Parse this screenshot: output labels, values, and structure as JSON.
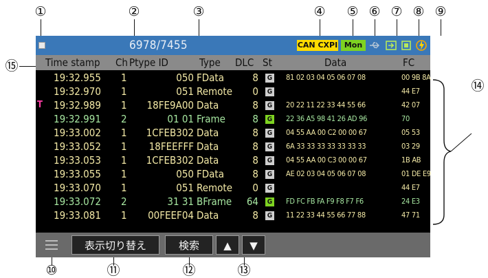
{
  "callouts": [
    "①",
    "②",
    "③",
    "④",
    "⑤",
    "⑥",
    "⑦",
    "⑧",
    "⑨",
    "⑩",
    "⑪",
    "⑫",
    "⑬",
    "⑭",
    "⑮"
  ],
  "status": {
    "frame_count": "6978/7455",
    "can_cxpi_label": "CAN CXPI",
    "mon_label": "Mon"
  },
  "columns": {
    "timestamp": "Time stamp",
    "ch": "Ch",
    "ptype": "Ptype ID",
    "type": "Type",
    "dlc": "DLC",
    "st": "St",
    "data": "Data",
    "fc": "FC"
  },
  "rows": [
    {
      "marker": "",
      "ts": "19:32.955",
      "ch": "1",
      "id": "050",
      "type": "FData",
      "dlc": "8",
      "st": "G",
      "data": "81 02 03 04 05 06 07 08",
      "fc": "00 9B 8A",
      "color": "#f3e9a6"
    },
    {
      "marker": "",
      "ts": "19:32.970",
      "ch": "1",
      "id": "051",
      "type": "Remote",
      "dlc": "0",
      "st": "G",
      "data": "",
      "fc": "44 E7",
      "color": "#f3e9a6"
    },
    {
      "marker": "T",
      "ts": "19:32.989",
      "ch": "1",
      "id": "18FE9A00",
      "type": "Data",
      "dlc": "8",
      "st": "G",
      "data": "20 22 11 22 33 44 55 66",
      "fc": "42 07",
      "color": "#f3e9a6"
    },
    {
      "marker": "",
      "ts": "19:32.991",
      "ch": "2",
      "id": "01 01",
      "type": "Frame",
      "dlc": "8",
      "st": "G",
      "data": "22 36 A5 98 41 26 AD 96",
      "fc": "70",
      "color": "#a6e6a0",
      "green": true
    },
    {
      "marker": "",
      "ts": "19:33.002",
      "ch": "1",
      "id": "1CFEB302",
      "type": "Data",
      "dlc": "8",
      "st": "G",
      "data": "04 55 AA 00 C2 00 00 67",
      "fc": "05 53",
      "color": "#f3e9a6"
    },
    {
      "marker": "",
      "ts": "19:33.052",
      "ch": "1",
      "id": "18FEEFFF",
      "type": "Data",
      "dlc": "8",
      "st": "G",
      "data": "6A 33 33 33 33 33 33 33",
      "fc": "03 29",
      "color": "#f3e9a6"
    },
    {
      "marker": "",
      "ts": "19:33.053",
      "ch": "1",
      "id": "1CFEB302",
      "type": "Data",
      "dlc": "8",
      "st": "G",
      "data": "04 55 AA 00 C3 00 00 67",
      "fc": "1B AB",
      "color": "#f3e9a6"
    },
    {
      "marker": "",
      "ts": "19:33.055",
      "ch": "1",
      "id": "050",
      "type": "FData",
      "dlc": "8",
      "st": "G",
      "data": "AE 02 03 04 05 06 07 08",
      "fc": "01 DE E9",
      "color": "#f3e9a6"
    },
    {
      "marker": "",
      "ts": "19:33.070",
      "ch": "1",
      "id": "051",
      "type": "Remote",
      "dlc": "0",
      "st": "G",
      "data": "",
      "fc": "44 E7",
      "color": "#f3e9a6"
    },
    {
      "marker": "",
      "ts": "19:33.072",
      "ch": "2",
      "id": "31 31",
      "type": "BFrame",
      "dlc": "64",
      "st": "G",
      "data": "FD FC FB FA F9 F8 F7 F6",
      "fc": "24 E3",
      "color": "#a6e6a0",
      "green": true
    },
    {
      "marker": "",
      "ts": "19:33.081",
      "ch": "1",
      "id": "00FEEF04",
      "type": "Data",
      "dlc": "8",
      "st": "G",
      "data": "11 22 33 44 55 66 77 88",
      "fc": "47 71",
      "color": "#f3e9a6"
    }
  ],
  "toolbar": {
    "display_switch": "表示切り替え",
    "search": "検索",
    "up": "▲",
    "down": "▼"
  }
}
